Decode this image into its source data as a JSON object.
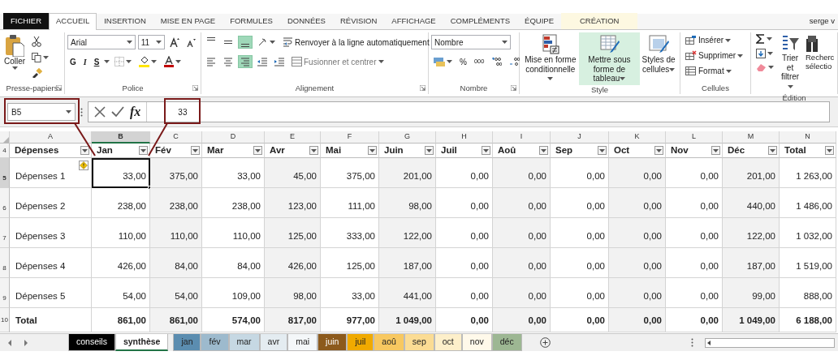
{
  "ribbon": {
    "tabs": [
      {
        "label": "FICHIER",
        "kind": "file",
        "selected": false
      },
      {
        "label": "ACCUEIL",
        "kind": "tab",
        "selected": true
      },
      {
        "label": "INSERTION",
        "kind": "tab",
        "selected": false
      },
      {
        "label": "MISE EN PAGE",
        "kind": "tab",
        "selected": false
      },
      {
        "label": "FORMULES",
        "kind": "tab",
        "selected": false
      },
      {
        "label": "DONNÉES",
        "kind": "tab",
        "selected": false
      },
      {
        "label": "RÉVISION",
        "kind": "tab",
        "selected": false
      },
      {
        "label": "AFFICHAGE",
        "kind": "tab",
        "selected": false
      },
      {
        "label": "COMPLÉMENTS",
        "kind": "tab",
        "selected": false
      },
      {
        "label": "ÉQUIPE",
        "kind": "tab",
        "selected": false
      },
      {
        "label": "CRÉATION",
        "kind": "contextual",
        "selected": false
      }
    ],
    "user": "serge v",
    "clipboard": {
      "title": "Presse-papiers",
      "paste": "Coller"
    },
    "font": {
      "title": "Police",
      "name": "Arial",
      "size": "11",
      "bold": "G",
      "italic": "I",
      "underline": "S"
    },
    "alignment": {
      "title": "Alignement",
      "wrap": "Renvoyer à la ligne automatiquement",
      "merge": "Fusionner et centrer",
      "vertical": [
        {
          "selected": false
        },
        {
          "selected": false
        },
        {
          "selected": true
        }
      ],
      "horizontal": [
        {
          "selected": false
        },
        {
          "selected": false
        },
        {
          "selected": true
        }
      ]
    },
    "number": {
      "title": "Nombre",
      "format": "Nombre",
      "percent": "%",
      "thousands": "000"
    },
    "styles": {
      "title": "Style",
      "items": [
        {
          "label": "Mise en forme conditionnelle",
          "kind": "conditional",
          "selected": false
        },
        {
          "label": "Mettre sous forme de tableau",
          "kind": "table",
          "selected": true
        },
        {
          "label": "Styles de cellules",
          "kind": "cellstyle",
          "selected": false
        }
      ]
    },
    "cells": {
      "title": "Cellules",
      "items": [
        {
          "label": "Insérer",
          "kind": "insert"
        },
        {
          "label": "Supprimer",
          "kind": "delete"
        },
        {
          "label": "Format",
          "kind": "format"
        }
      ]
    },
    "editing": {
      "title": "Édition",
      "sort": "Trier et filtrer",
      "find_lines": [
        "Recherc",
        "sélectio"
      ]
    }
  },
  "formula_bar": {
    "name_box": "B5",
    "function_label": "fx",
    "formula": "33"
  },
  "sheet": {
    "columns": [
      {
        "letter": "A",
        "header": "Dépenses",
        "selected": false
      },
      {
        "letter": "B",
        "header": "Jan",
        "selected": true
      },
      {
        "letter": "C",
        "header": "Fév",
        "selected": false
      },
      {
        "letter": "D",
        "header": "Mar",
        "selected": false
      },
      {
        "letter": "E",
        "header": "Avr",
        "selected": false
      },
      {
        "letter": "F",
        "header": "Mai",
        "selected": false
      },
      {
        "letter": "G",
        "header": "Juin",
        "selected": false
      },
      {
        "letter": "H",
        "header": "Juil",
        "selected": false
      },
      {
        "letter": "I",
        "header": "Aoû",
        "selected": false
      },
      {
        "letter": "J",
        "header": "Sep",
        "selected": false
      },
      {
        "letter": "K",
        "header": "Oct",
        "selected": false
      },
      {
        "letter": "L",
        "header": "Nov",
        "selected": false
      },
      {
        "letter": "M",
        "header": "Déc",
        "selected": false
      },
      {
        "letter": "N",
        "header": "Total",
        "selected": false
      }
    ],
    "header_row": "4",
    "rows": [
      {
        "number": "5",
        "kind": "data",
        "selected": true,
        "warning": true,
        "cells": [
          "Dépenses 1",
          "33,00",
          "375,00",
          "33,00",
          "45,00",
          "375,00",
          "201,00",
          "0,00",
          "0,00",
          "0,00",
          "0,00",
          "0,00",
          "201,00",
          "1 263,00"
        ]
      },
      {
        "number": "6",
        "kind": "data",
        "selected": false,
        "warning": false,
        "cells": [
          "Dépenses 2",
          "238,00",
          "238,00",
          "238,00",
          "123,00",
          "111,00",
          "98,00",
          "0,00",
          "0,00",
          "0,00",
          "0,00",
          "0,00",
          "440,00",
          "1 486,00"
        ]
      },
      {
        "number": "7",
        "kind": "data",
        "selected": false,
        "warning": false,
        "cells": [
          "Dépenses 3",
          "110,00",
          "110,00",
          "110,00",
          "125,00",
          "333,00",
          "122,00",
          "0,00",
          "0,00",
          "0,00",
          "0,00",
          "0,00",
          "122,00",
          "1 032,00"
        ]
      },
      {
        "number": "8",
        "kind": "data",
        "selected": false,
        "warning": false,
        "cells": [
          "Dépenses 4",
          "426,00",
          "84,00",
          "84,00",
          "426,00",
          "125,00",
          "187,00",
          "0,00",
          "0,00",
          "0,00",
          "0,00",
          "0,00",
          "187,00",
          "1 519,00"
        ]
      },
      {
        "number": "9",
        "kind": "data",
        "selected": false,
        "warning": false,
        "cells": [
          "Dépenses 5",
          "54,00",
          "54,00",
          "109,00",
          "98,00",
          "33,00",
          "441,00",
          "0,00",
          "0,00",
          "0,00",
          "0,00",
          "0,00",
          "99,00",
          "888,00"
        ]
      },
      {
        "number": "10",
        "kind": "total",
        "selected": false,
        "warning": false,
        "cells": [
          "Total",
          "861,00",
          "861,00",
          "574,00",
          "817,00",
          "977,00",
          "1 049,00",
          "0,00",
          "0,00",
          "0,00",
          "0,00",
          "0,00",
          "1 049,00",
          "6 188,00"
        ]
      }
    ]
  },
  "sheet_tabs": [
    {
      "label": "conseils",
      "color": "#000000",
      "selected": false
    },
    {
      "label": "synthèse",
      "selected": true
    },
    {
      "label": "jan",
      "color": "#5b8db0",
      "selected": false
    },
    {
      "label": "fév",
      "color": "#9dbacd",
      "selected": false
    },
    {
      "label": "mar",
      "color": "#c6d8e3",
      "selected": false
    },
    {
      "label": "avr",
      "color": "#e4ecf1",
      "selected": false
    },
    {
      "label": "mai",
      "color": "#f4f7f9",
      "selected": false
    },
    {
      "label": "juin",
      "color": "#8c5a1c",
      "selected": false
    },
    {
      "label": "juil",
      "color": "#f0aa00",
      "selected": false
    },
    {
      "label": "aoû",
      "color": "#f8c860",
      "selected": false
    },
    {
      "label": "sep",
      "color": "#fbdc94",
      "selected": false
    },
    {
      "label": "oct",
      "color": "#fdefca",
      "selected": false
    },
    {
      "label": "nov",
      "color": "#fff9ea",
      "selected": false
    },
    {
      "label": "déc",
      "color": "#9db793",
      "selected": false
    }
  ]
}
